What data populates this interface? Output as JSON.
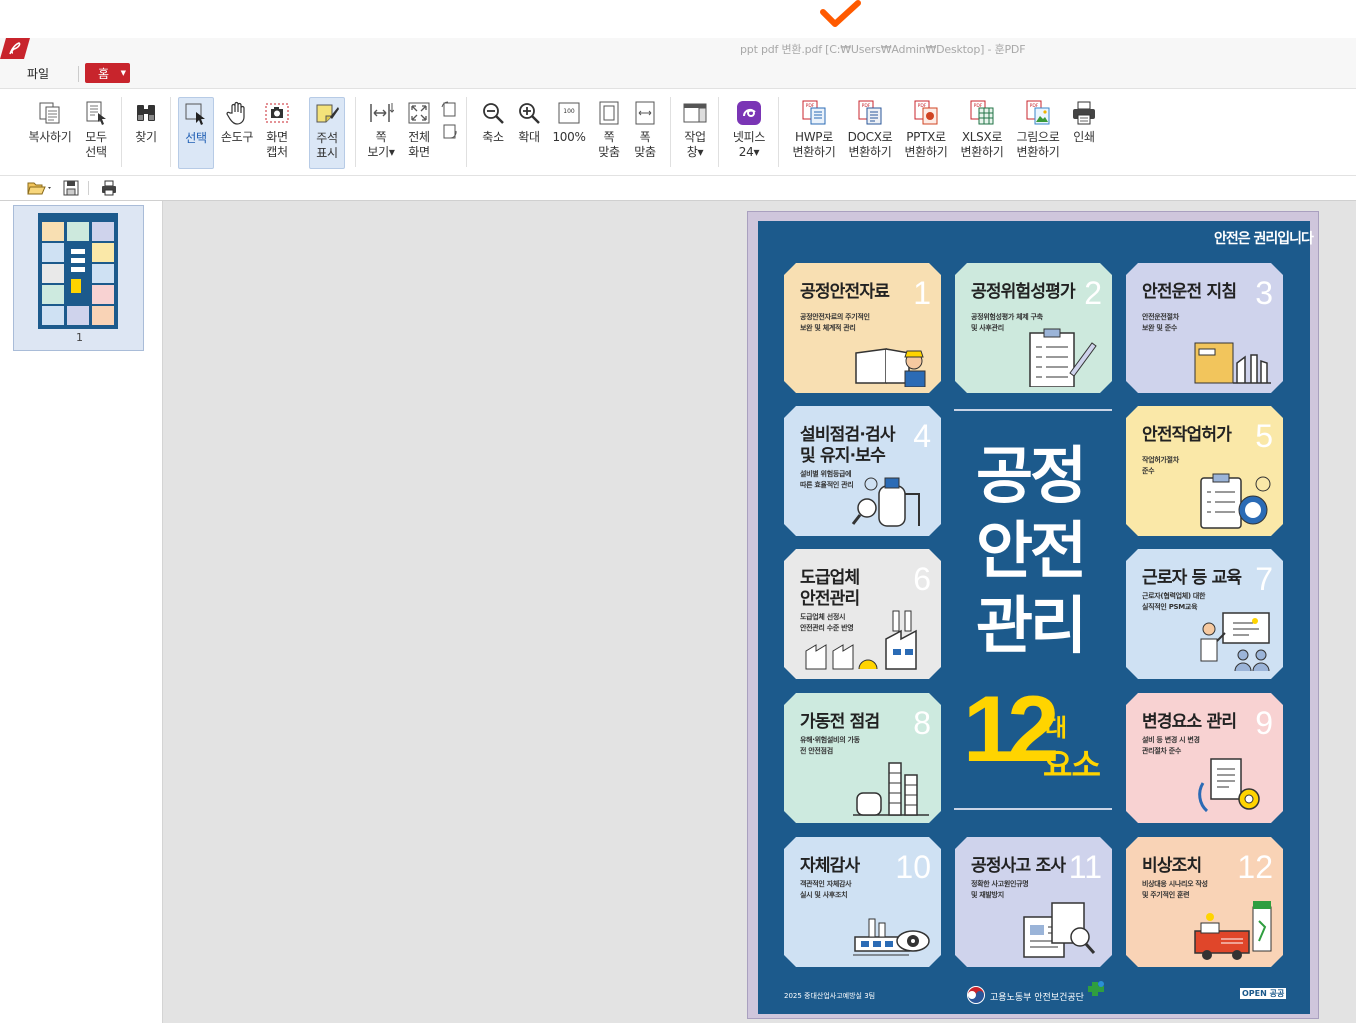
{
  "window": {
    "title": "ppt pdf 변환.pdf [C:₩Users₩Admin₩Desktop] - 훈PDF",
    "accent": "#c8242c",
    "annotation_color": "#ff5a00"
  },
  "menu": {
    "file": "파일",
    "home": "홈"
  },
  "ribbon": [
    {
      "id": "copy",
      "label": "복사하기",
      "icon": "copy-icon"
    },
    {
      "id": "select-all",
      "label": "모두\n선택",
      "icon": "select-all-icon"
    },
    {
      "id": "find",
      "label": "찾기",
      "icon": "binoculars-icon"
    },
    {
      "id": "select",
      "label": "선택",
      "icon": "cursor-icon"
    },
    {
      "id": "hand",
      "label": "손도구",
      "icon": "hand-icon"
    },
    {
      "id": "capture",
      "label": "화면\n캡처",
      "icon": "camera-icon"
    },
    {
      "id": "annotate",
      "label": "주석\n표시",
      "icon": "annotate-icon"
    },
    {
      "id": "page-view",
      "label": "쪽\n보기▾",
      "icon": "page-view-icon"
    },
    {
      "id": "fullscreen",
      "label": "전체\n화면",
      "icon": "fullscreen-icon"
    },
    {
      "id": "zoom-out",
      "label": "축소",
      "icon": "zoom-out-icon"
    },
    {
      "id": "zoom-in",
      "label": "확대",
      "icon": "zoom-in-icon"
    },
    {
      "id": "zoom-100",
      "label": "100%",
      "icon": "zoom-100-icon"
    },
    {
      "id": "fit-page",
      "label": "쪽\n맞춤",
      "icon": "fit-page-icon"
    },
    {
      "id": "fit-width",
      "label": "폭\n맞춤",
      "icon": "fit-width-icon"
    },
    {
      "id": "task-window",
      "label": "작업\n창▾",
      "icon": "task-window-icon"
    },
    {
      "id": "netpiece",
      "label": "넷피스\n24▾",
      "icon": "netpiece-icon"
    },
    {
      "id": "to-hwp",
      "label": "HWP로\n변환하기",
      "icon": "pdf-to-hwp-icon"
    },
    {
      "id": "to-docx",
      "label": "DOCX로\n변환하기",
      "icon": "pdf-to-docx-icon"
    },
    {
      "id": "to-pptx",
      "label": "PPTX로\n변환하기",
      "icon": "pdf-to-pptx-icon"
    },
    {
      "id": "to-xlsx",
      "label": "XLSX로\n변환하기",
      "icon": "pdf-to-xlsx-icon"
    },
    {
      "id": "to-image",
      "label": "그림으로\n변환하기",
      "icon": "pdf-to-image-icon"
    },
    {
      "id": "print",
      "label": "인쇄",
      "icon": "printer-icon"
    }
  ],
  "sidebar": {
    "page_number": "1"
  },
  "poster": {
    "brand": "안전은 권리입니다",
    "title": "공정\n안전\n관리",
    "twelve": "12",
    "dae": "대",
    "yoso": "요소",
    "footer_left": "2025 중대산업사고예방실 3팀",
    "footer_center": "고용노동부  안전보건공단",
    "footer_right": "OPEN 공공",
    "cards": [
      {
        "title": "공정안전자료",
        "sub": "공정안전자료의 주기적인\n보완 및 체계적 관리",
        "num": "1",
        "color": "#f8dfb2"
      },
      {
        "title": "공정위험성평가",
        "sub": "공정위험성평가 체제 구축\n및 사후관리",
        "num": "2",
        "color": "#cde9dd"
      },
      {
        "title": "안전운전 지침",
        "sub": "안전운전절차\n보완 및 준수",
        "num": "3",
        "color": "#cfd3ec"
      },
      {
        "title": "설비점검·검사\n및 유지·보수",
        "sub": "설비별 위험등급에\n따른 효율적인 관리",
        "num": "4",
        "color": "#cfe1f3"
      },
      {
        "title": "안전작업허가",
        "sub": "작업허가절차\n준수",
        "num": "5",
        "color": "#fae8a8"
      },
      {
        "title": "도급업체\n안전관리",
        "sub": "도급업체 선정시\n안전관리 수준 반영",
        "num": "6",
        "color": "#e9e9e9"
      },
      {
        "title": "근로자 등 교육",
        "sub": "근로자(협력업체) 대한\n실직적인 PSM교육",
        "num": "7",
        "color": "#cfe1f3"
      },
      {
        "title": "가동전 점검",
        "sub": "유해·위험설비의 가동\n전 안전점검",
        "num": "8",
        "color": "#cdeadf"
      },
      {
        "title": "변경요소 관리",
        "sub": "설비 등 변경 시 변경\n관리절차 준수",
        "num": "9",
        "color": "#f8d2d2"
      },
      {
        "title": "자체감사",
        "sub": "객관적인 자체감사\n실시 및 사후조치",
        "num": "10",
        "color": "#cfe1f3"
      },
      {
        "title": "공정사고 조사",
        "sub": "정확한 사고원인규명\n및 재발방지",
        "num": "11",
        "color": "#cfd3ec"
      },
      {
        "title": "비상조치",
        "sub": "비상대응 시나리오 작성\n및 주기적인 훈련",
        "num": "12",
        "color": "#f9d3b6"
      }
    ]
  }
}
